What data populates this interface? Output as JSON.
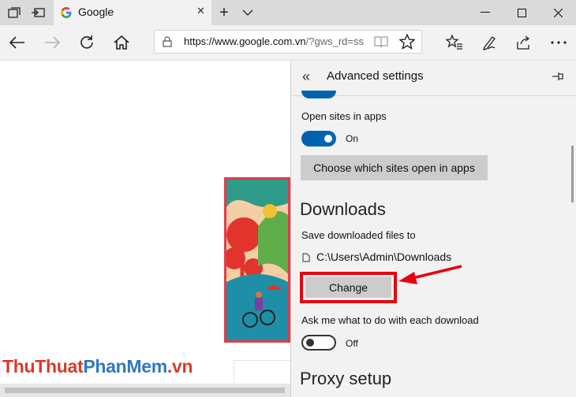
{
  "tab": {
    "title": "Google",
    "close": "✕"
  },
  "window": {
    "minimize": "—",
    "maximize": "☐",
    "close": "✕"
  },
  "tabbar": {
    "new_tab": "+",
    "tab_list": "⌄"
  },
  "address": {
    "url_host": "https://www.google.com.vn",
    "url_rest": "/?gws_rd=ssl"
  },
  "watermark": {
    "part1": "ThuThuat",
    "part2": "PhanMem",
    "part3": ".vn"
  },
  "panel": {
    "back": "«",
    "title": "Advanced settings",
    "pin": "⊣⊢",
    "open_sites": {
      "label": "Open sites in apps",
      "state": "On",
      "button": "Choose which sites open in apps"
    },
    "downloads": {
      "heading": "Downloads",
      "save_label": "Save downloaded files to",
      "path": "C:\\Users\\Admin\\Downloads",
      "change_button": "Change",
      "ask_label": "Ask me what to do with each download",
      "ask_state": "Off"
    },
    "proxy": {
      "heading": "Proxy setup"
    }
  },
  "colors": {
    "accent": "#0063b1",
    "highlight": "#e8000e",
    "panel_bg": "#f2f2f2",
    "tabbar_bg": "#dadada"
  }
}
